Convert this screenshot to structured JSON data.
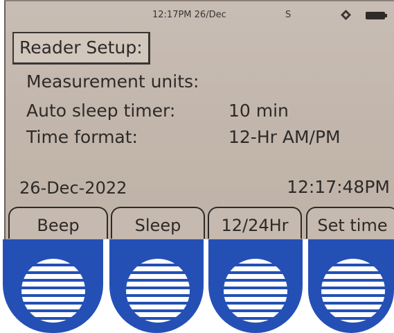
{
  "status_bar": {
    "time_date": "12:17PM 26/Dec",
    "indicator": "S",
    "direction_icon": "diamond-nav-icon",
    "battery_icon": "battery-icon"
  },
  "screen": {
    "title": "Reader Setup:",
    "fields": [
      {
        "label": "Measurement units:",
        "value": ""
      },
      {
        "label": "Auto sleep timer:",
        "value": "10 min"
      },
      {
        "label": "Time format:",
        "value": "12-Hr AM/PM"
      }
    ],
    "date": "26-Dec-2022",
    "clock": "12:17:48PM"
  },
  "softkeys": [
    {
      "label": "Beep"
    },
    {
      "label": "Sleep"
    },
    {
      "label": "12/24Hr"
    },
    {
      "label": "Set time"
    }
  ],
  "colors": {
    "lcd_background": "#c3b7ad",
    "lcd_text": "#2e2a27",
    "button_blue": "#2450b6",
    "grille_white": "#ffffff"
  }
}
